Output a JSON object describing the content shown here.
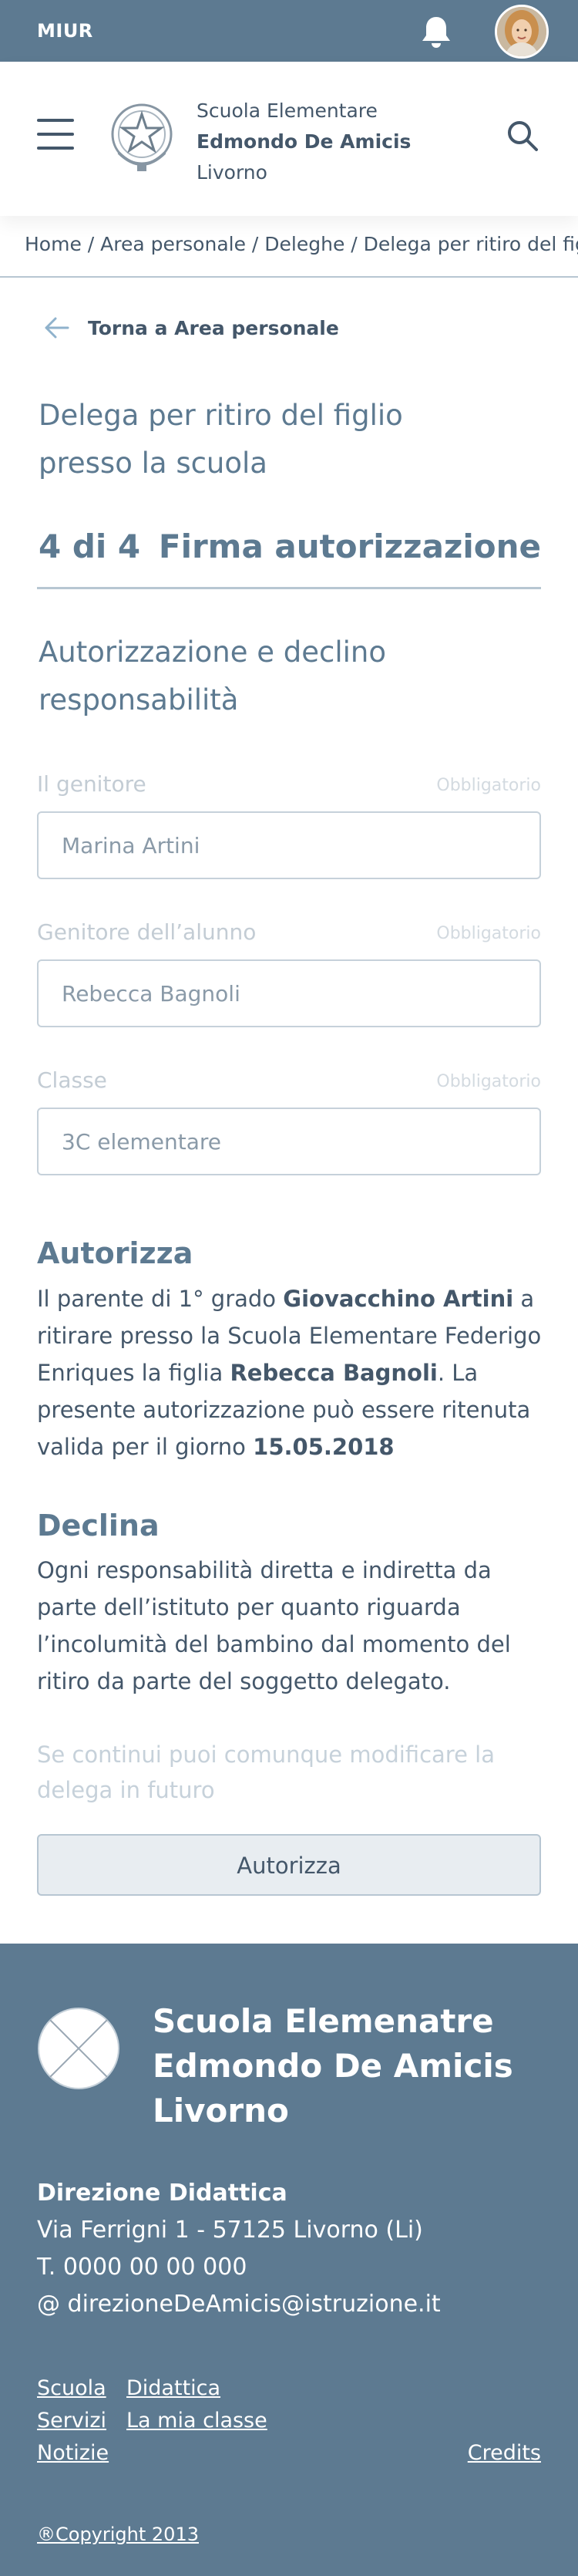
{
  "topbar": {
    "brand": "MIUR",
    "bell_icon": "bell-icon",
    "avatar": "user-avatar"
  },
  "header": {
    "menu_icon": "hamburger-menu-icon",
    "logo_icon": "italian-republic-emblem-icon",
    "school_line1": "Scuola Elementare",
    "school_line2": "Edmondo De Amicis",
    "school_line3": "Livorno",
    "search_icon": "search-icon"
  },
  "breadcrumb": "Home / Area personale / Deleghe / Delega per ritiro del figlio presso la scuola",
  "back_link": {
    "icon": "arrow-left-icon",
    "label": "Torna a Area personale"
  },
  "page_title": {
    "line1": "Delega per ritiro del figlio",
    "line2": "presso la scuola"
  },
  "step": {
    "count": "4 di 4",
    "name": "Firma autorizzazione"
  },
  "section_title": {
    "line1": "Autorizzazione e declino",
    "line2": "responsabilità"
  },
  "fields": [
    {
      "label": "Il genitore",
      "required": "Obbligatorio",
      "value": "Marina Artini"
    },
    {
      "label": "Genitore dell’alunno",
      "required": "Obbligatorio",
      "value": "Rebecca Bagnoli"
    },
    {
      "label": "Classe",
      "required": "Obbligatorio",
      "value": "3C elementare"
    }
  ],
  "authorize": {
    "title": "Autorizza",
    "t1": "Il parente di 1° grado ",
    "b1": "Giovacchino Artini",
    "t2": " a ritirare presso la Scuola Elementare Federigo Enriques la figlia ",
    "b2": "Rebecca Bagnoli",
    "t3": ". La presente autorizzazione può essere ritenuta valida per il giorno ",
    "b3": "15.05.2018"
  },
  "decline": {
    "title": "Declina",
    "text": "Ogni responsabilità diretta e indiretta da parte dell’istituto per quanto riguarda l’incolumità del bambino dal momento del ritiro da parte del soggetto delegato."
  },
  "hint": "Se continui puoi comunque modificare la delega in futuro",
  "submit_button": "Autorizza",
  "footer": {
    "logo_icon": "placeholder-logo-icon",
    "name_line1": "Scuola Elemenatre",
    "name_line2": "Edmondo De Amicis",
    "name_line3": "Livorno",
    "heading": "Direzione Didattica",
    "address": "Via Ferrigni 1 - 57125 Livorno (Li)",
    "phone": "T. 0000 00 00 000",
    "email": "@ direzioneDeAmicis@istruzione.it",
    "links": {
      "scuola": "Scuola",
      "didattica": "Didattica",
      "servizi": "Servizi",
      "classe": "La mia classe",
      "notizie": "Notizie",
      "credits": "Credits"
    },
    "copyright": "®Copyright 2013"
  },
  "colors": {
    "primary": "#5d7a91",
    "text": "#44576a",
    "muted": "#c6d1da",
    "button_bg": "#e8edf1"
  }
}
